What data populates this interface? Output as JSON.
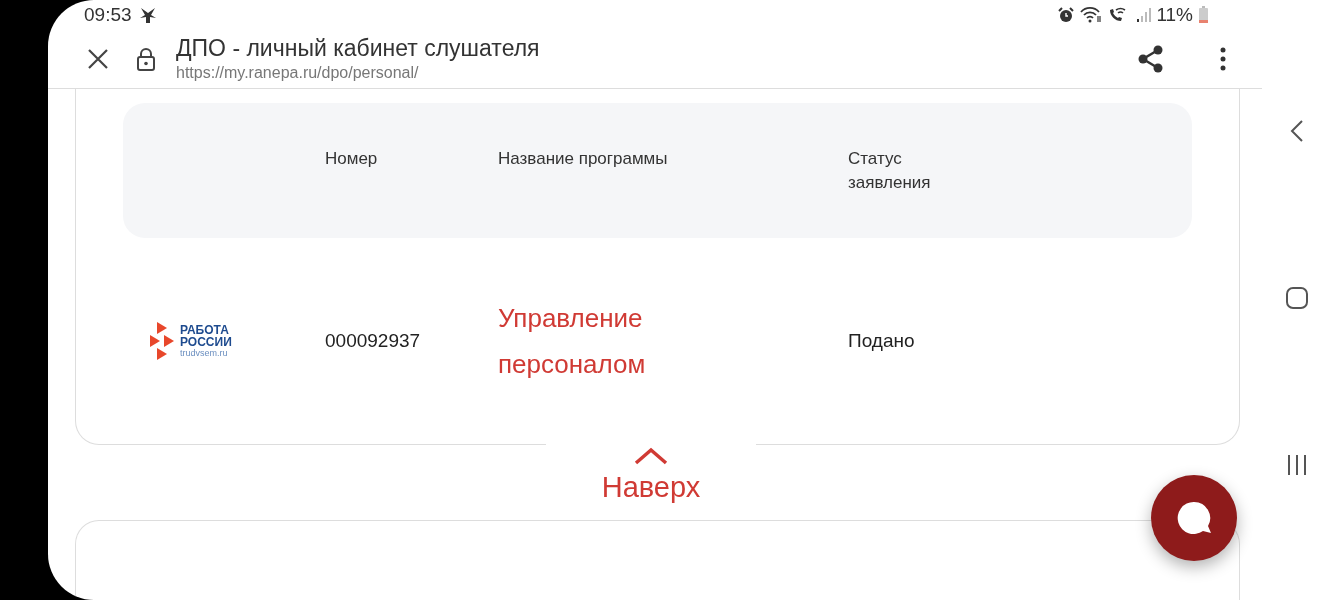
{
  "status_bar": {
    "time": "09:53",
    "battery_text": "11%"
  },
  "browser": {
    "page_title": "ДПО - личный кабинет слушателя",
    "url": "https://my.ranepa.ru/dpo/personal/"
  },
  "table": {
    "columns": [
      "Номер",
      "Название программы",
      "Статус заявления"
    ],
    "rows": [
      {
        "logo": {
          "line_1": "РАБОТА",
          "line_2": "РОССИИ",
          "site": "trudvsem.ru"
        },
        "number": "000092937",
        "program": "Управление персоналом",
        "status": "Подано"
      }
    ]
  },
  "scroll_top": {
    "label": "Наверх"
  }
}
